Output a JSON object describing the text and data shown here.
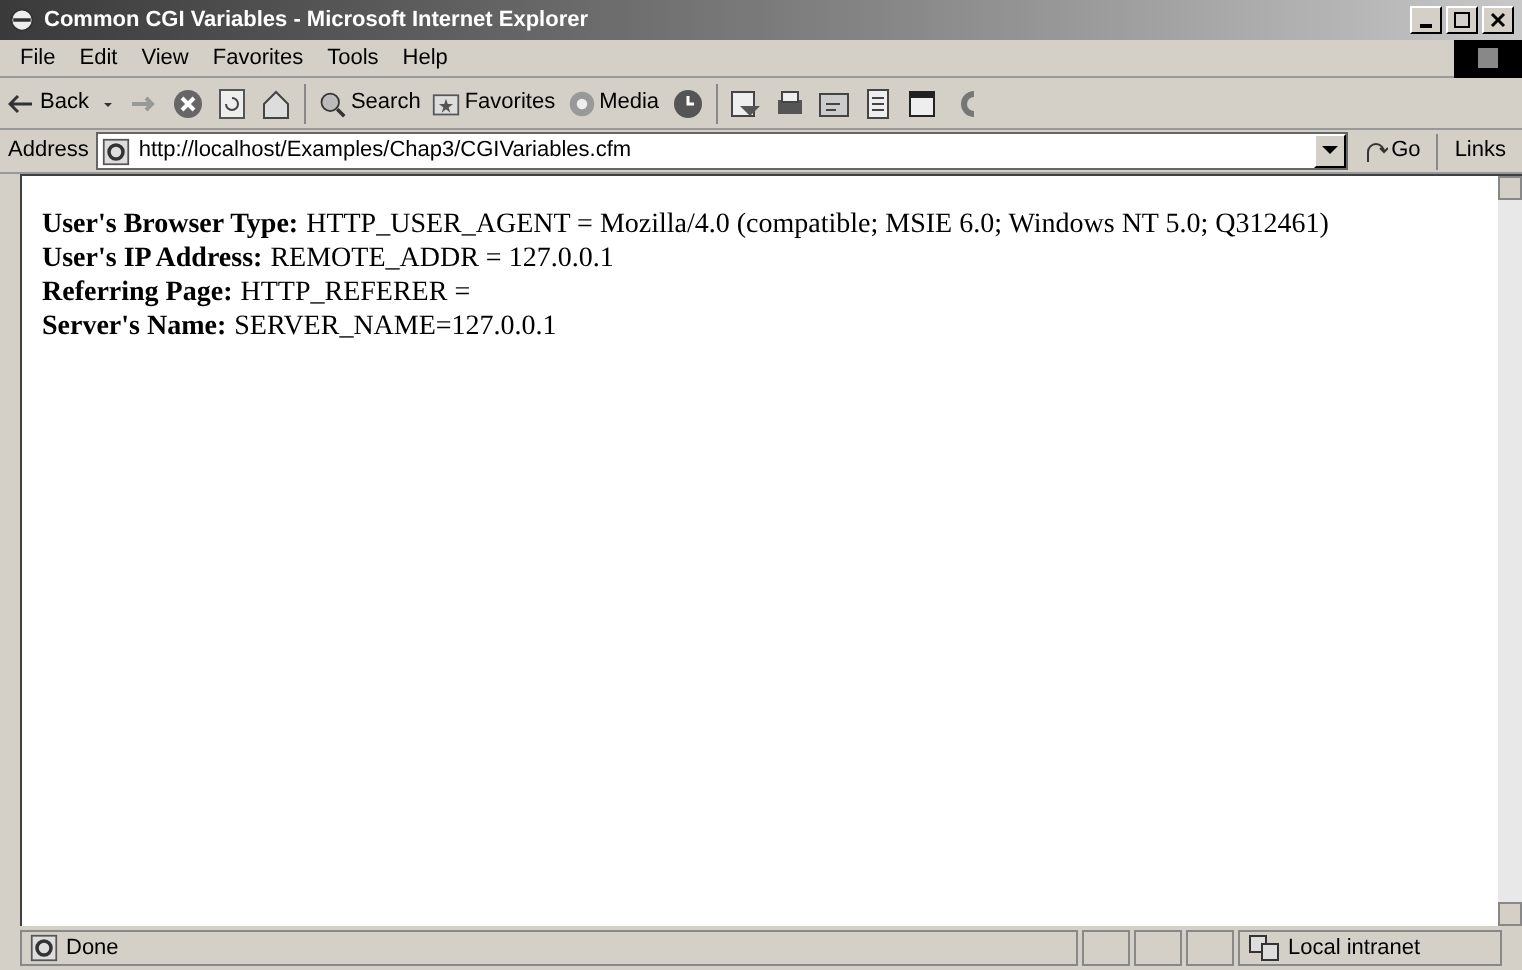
{
  "window": {
    "title": "Common CGI Variables - Microsoft Internet Explorer"
  },
  "menu": [
    "File",
    "Edit",
    "View",
    "Favorites",
    "Tools",
    "Help"
  ],
  "toolbar": {
    "back": "Back",
    "search": "Search",
    "favorites": "Favorites",
    "media": "Media"
  },
  "address": {
    "label": "Address",
    "value": "http://localhost/Examples/Chap3/CGIVariables.cfm",
    "go": "Go",
    "links": "Links"
  },
  "content": [
    {
      "label": "User's Browser Type:",
      "value": "HTTP_USER_AGENT = Mozilla/4.0 (compatible; MSIE 6.0; Windows NT 5.0; Q312461)"
    },
    {
      "label": "User's IP Address:",
      "value": "REMOTE_ADDR = 127.0.0.1"
    },
    {
      "label": "Referring Page:",
      "value": "HTTP_REFERER ="
    },
    {
      "label": "Server's Name:",
      "value": "SERVER_NAME=127.0.0.1"
    }
  ],
  "status_bar": {
    "text": "Done",
    "zone": "Local intranet"
  }
}
